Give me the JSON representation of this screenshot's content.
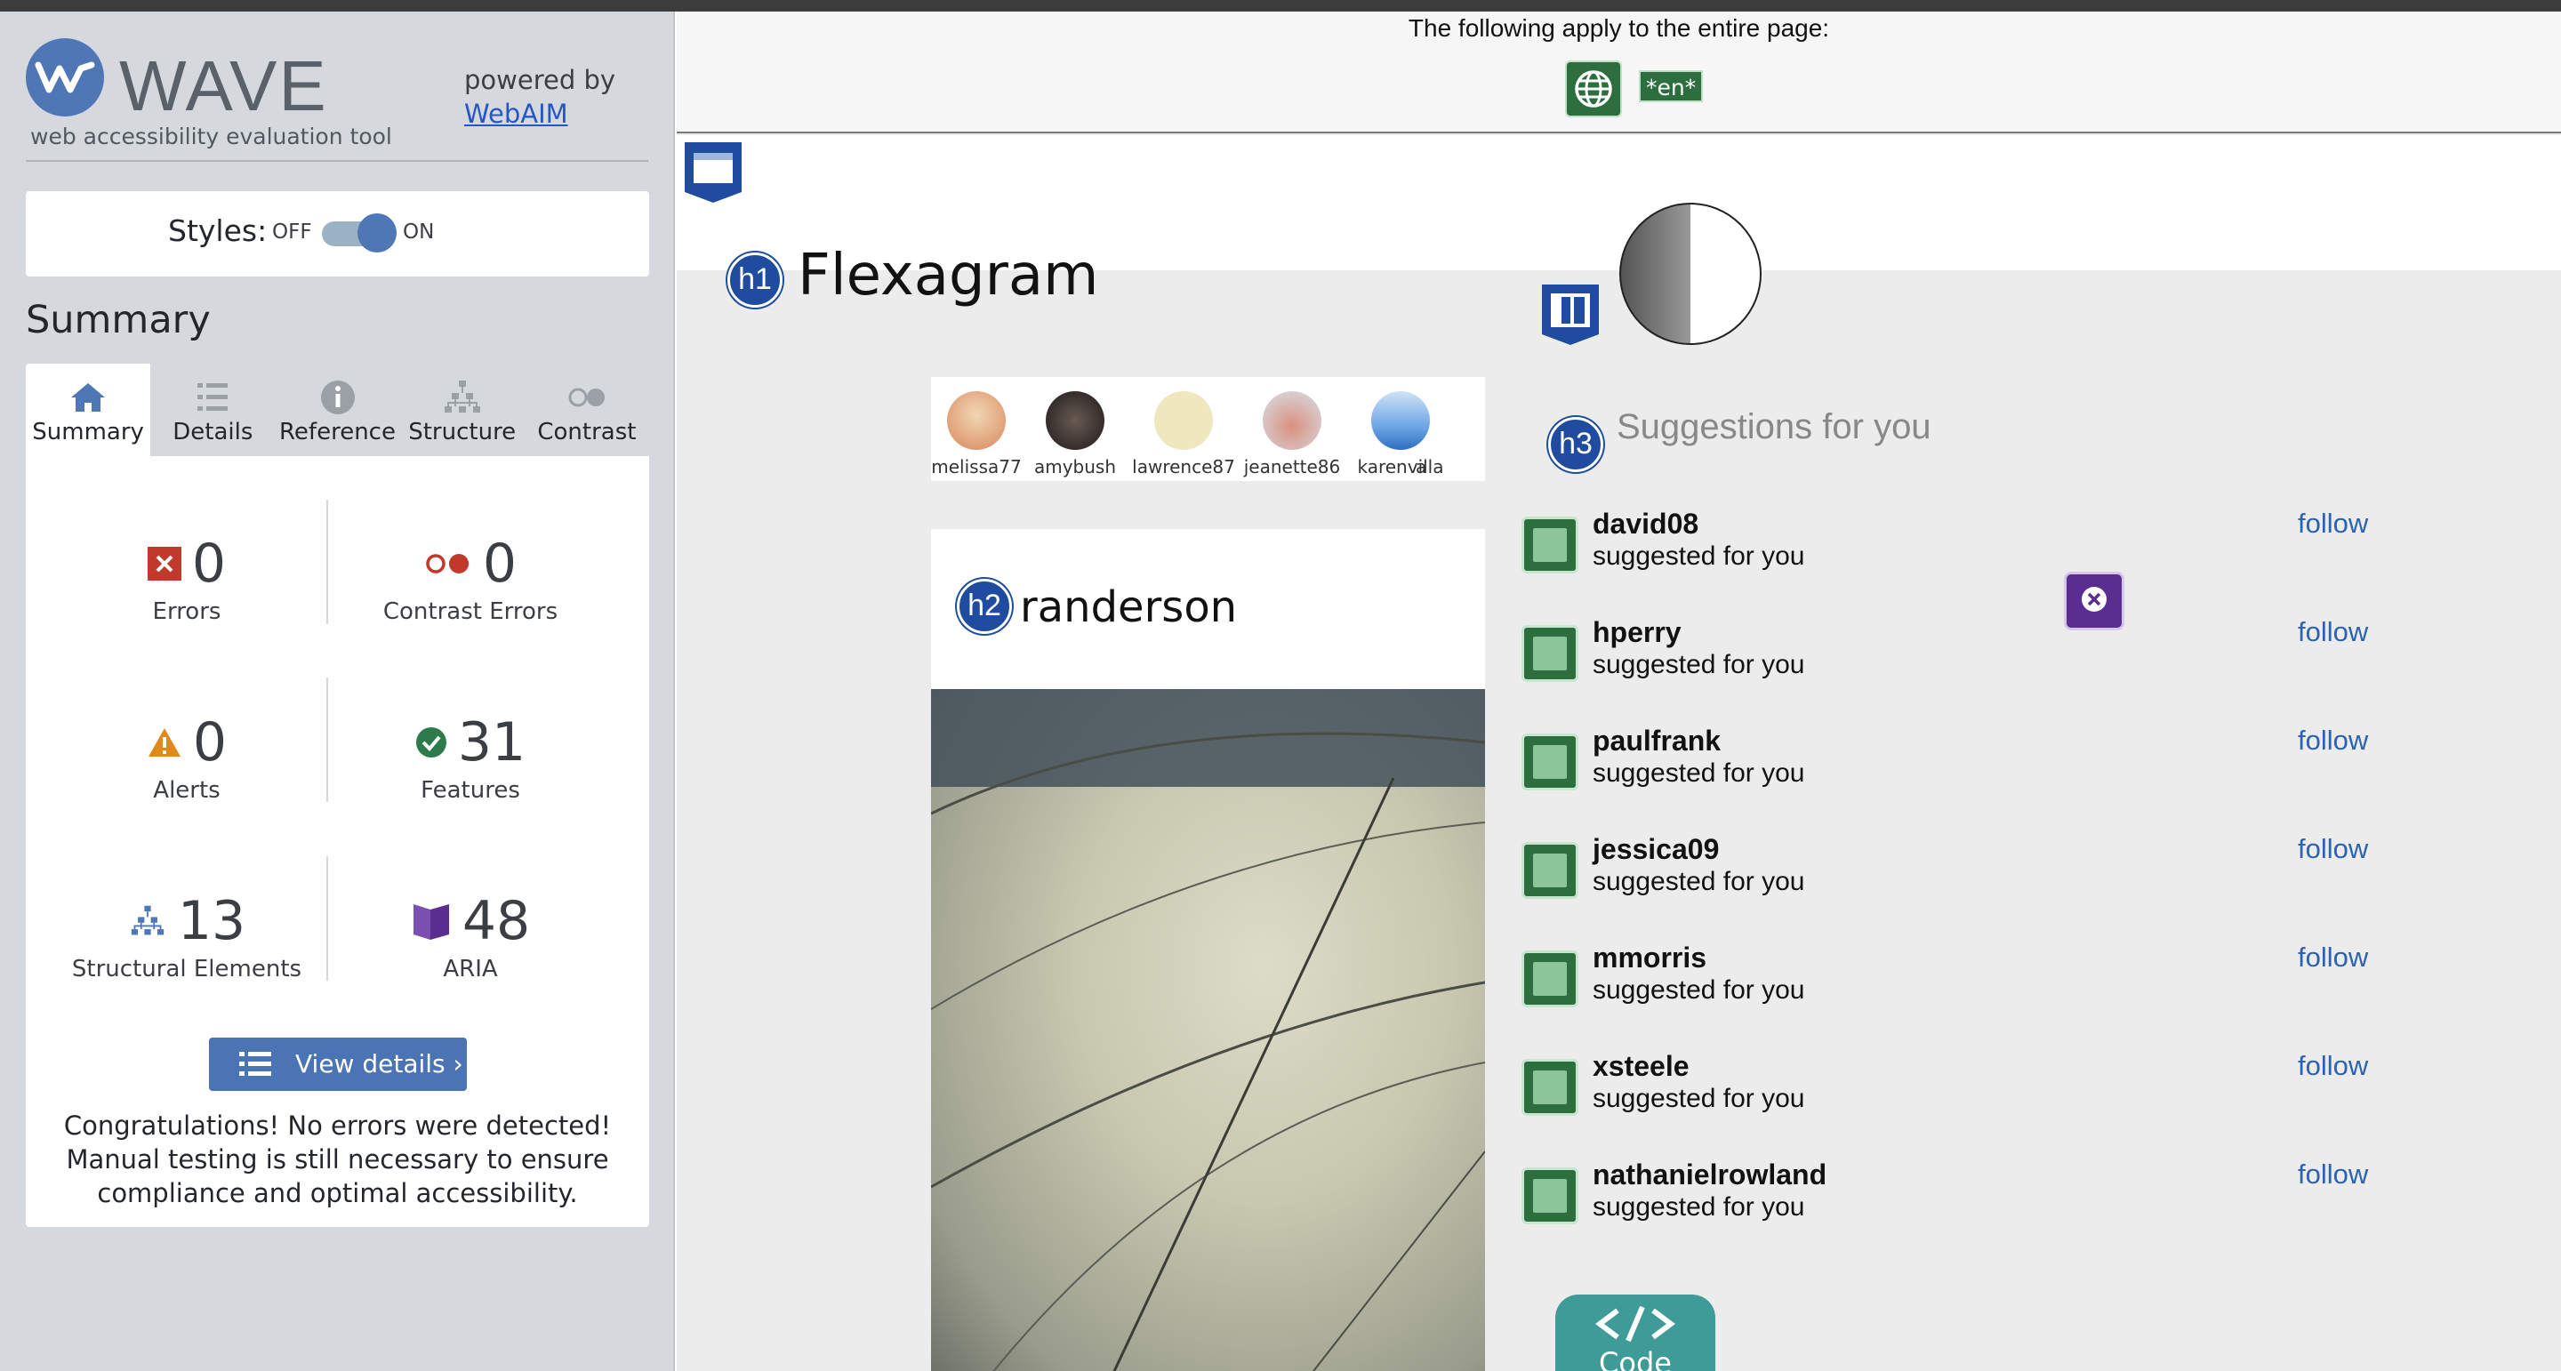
{
  "sidebar": {
    "brand": "WAVE",
    "tagline": "web accessibility evaluation tool",
    "powered_by": "powered by",
    "powered_link": "WebAIM",
    "styles_label": "Styles:",
    "styles_off": "OFF",
    "styles_on": "ON",
    "summary_heading": "Summary",
    "tabs": [
      {
        "label": "Summary",
        "icon": "home-icon"
      },
      {
        "label": "Details",
        "icon": "list-icon"
      },
      {
        "label": "Reference",
        "icon": "info-icon"
      },
      {
        "label": "Structure",
        "icon": "structure-icon"
      },
      {
        "label": "Contrast",
        "icon": "contrast-icon"
      }
    ],
    "stats": {
      "errors": {
        "value": "0",
        "label": "Errors"
      },
      "contrast_errors": {
        "value": "0",
        "label": "Contrast Errors"
      },
      "alerts": {
        "value": "0",
        "label": "Alerts"
      },
      "features": {
        "value": "31",
        "label": "Features"
      },
      "structural": {
        "value": "13",
        "label": "Structural Elements"
      },
      "aria": {
        "value": "48",
        "label": "ARIA"
      }
    },
    "view_details": "View details ›",
    "congrats": "Congratulations! No errors were detected! Manual testing is still necessary to ensure compliance and optimal accessibility."
  },
  "page": {
    "apply_text": "The following apply to the entire page:",
    "lang_tag": "*en*",
    "h1_badge": "h1",
    "title": "Flexagram",
    "stories": [
      "melissa77",
      "amybush",
      "lawrence87",
      "jeanette86",
      "karenvilla",
      "a"
    ],
    "h2_badge": "h2",
    "post_user": "randerson",
    "h3_badge": "h3",
    "suggestions_heading": "Suggestions for you",
    "suggestions": [
      {
        "name": "david08",
        "sub": "suggested for you",
        "action": "follow"
      },
      {
        "name": "hperry",
        "sub": "suggested for you",
        "action": "follow"
      },
      {
        "name": "paulfrank",
        "sub": "suggested for you",
        "action": "follow"
      },
      {
        "name": "jessica09",
        "sub": "suggested for you",
        "action": "follow"
      },
      {
        "name": "mmorris",
        "sub": "suggested for you",
        "action": "follow"
      },
      {
        "name": "xsteele",
        "sub": "suggested for you",
        "action": "follow"
      },
      {
        "name": "nathanielrowland",
        "sub": "suggested for you",
        "action": "follow"
      }
    ],
    "code_label": "Code"
  },
  "colors": {
    "wave_blue": "#4f77b6",
    "error_red": "#c0392b",
    "alert_orange": "#e08a1e",
    "feature_green": "#2d6e3e",
    "aria_purple": "#5a2d91",
    "link_blue": "#2a63b0"
  }
}
